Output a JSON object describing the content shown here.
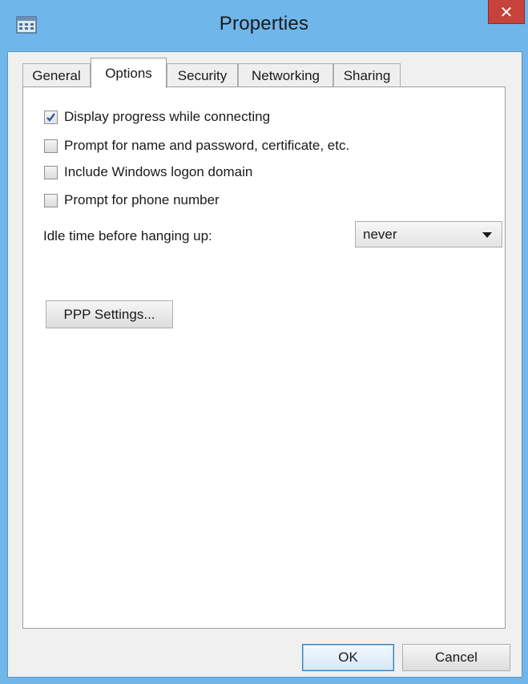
{
  "window": {
    "title": "Properties",
    "close_symbol": "✕",
    "icon": "phonebook-icon"
  },
  "tabs": [
    {
      "label": "General",
      "active": false
    },
    {
      "label": "Options",
      "active": true
    },
    {
      "label": "Security",
      "active": false
    },
    {
      "label": "Networking",
      "active": false
    },
    {
      "label": "Sharing",
      "active": false
    }
  ],
  "options": {
    "checkboxes": [
      {
        "label": "Display progress while connecting",
        "checked": true
      },
      {
        "label": "Prompt for name and password, certificate, etc.",
        "checked": false
      },
      {
        "label": "Include Windows logon domain",
        "checked": false
      },
      {
        "label": "Prompt for phone number",
        "checked": false
      }
    ],
    "idle_label": "Idle time before hanging up:",
    "idle_value": "never",
    "ppp_button": "PPP Settings..."
  },
  "footer": {
    "ok_label": "OK",
    "cancel_label": "Cancel"
  }
}
